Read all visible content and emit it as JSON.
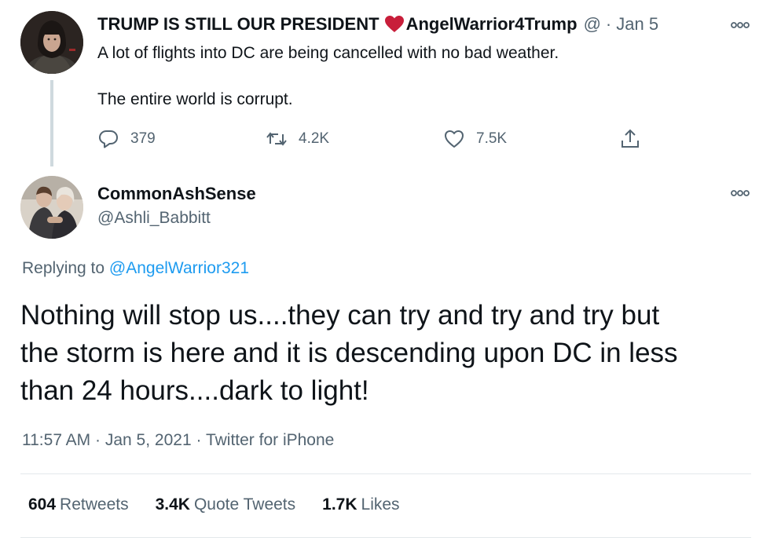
{
  "reply_to_tweet": {
    "display_name": "TRUMP IS STILL OUR PRESIDENT",
    "display_name_suffix": "AngelWarrior4Trump",
    "handle": "@",
    "separator": "·",
    "date": "Jan 5",
    "text_line1": "A lot of flights into DC are being cancelled with no bad weather.",
    "text_line2": "The entire world is corrupt.",
    "replies": "379",
    "retweets": "4.2K",
    "likes": "7.5K",
    "icons": [
      "heart-icon",
      "reply-icon",
      "retweet-icon",
      "like-icon",
      "share-icon",
      "more-icon"
    ],
    "heart_color": "#c81e3a"
  },
  "main_tweet": {
    "display_name": "CommonAshSense",
    "handle": "@Ashli_Babbitt",
    "replying_prefix": "Replying to",
    "replying_handle": "@AngelWarrior321",
    "body_lines": [
      "Nothing will stop us....they can try and try and try but",
      "the storm is here and it is descending upon DC in less",
      "than 24 hours....dark to light!"
    ],
    "time": "11:57 AM",
    "separator": "·",
    "date": "Jan 5, 2021",
    "source": "Twitter for iPhone",
    "stats": {
      "retweets_count": "604",
      "retweets_label": "Retweets",
      "quote_count": "3.4K",
      "quote_label": "Quote Tweets",
      "likes_count": "1.7K",
      "likes_label": "Likes"
    }
  },
  "colors": {
    "text": "#0f1419",
    "secondary": "#536471",
    "link": "#1d9bf0",
    "divider": "#e3e8eb",
    "thread_line": "#cfd9de"
  }
}
